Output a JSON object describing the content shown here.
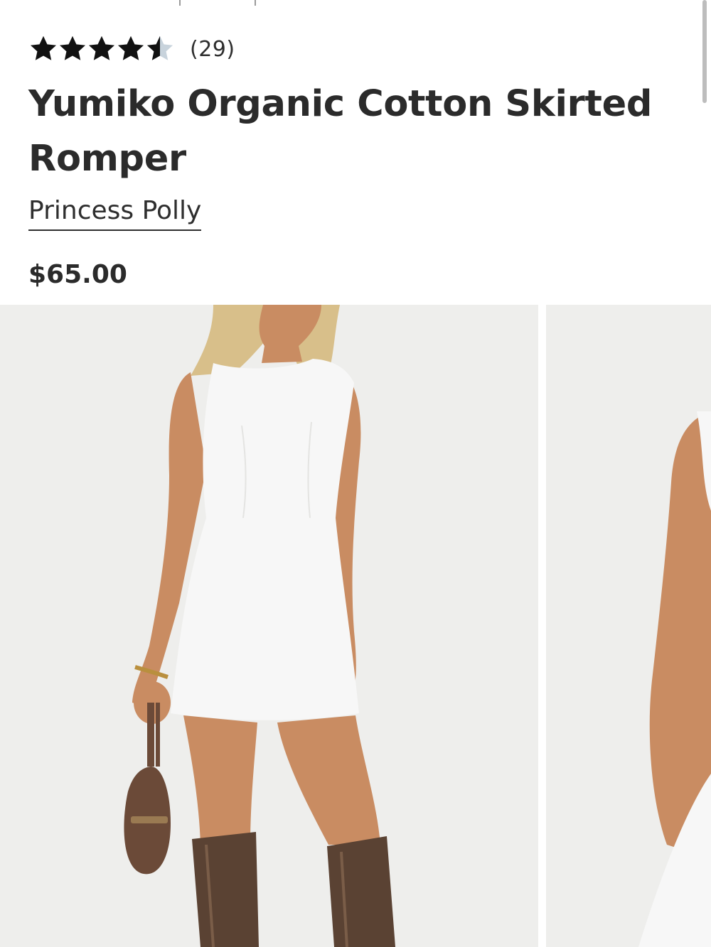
{
  "rating": {
    "value": 4.5,
    "max": 5,
    "count_text": "(29)",
    "star_color": "#111111",
    "empty_star_color": "#c8d3dc"
  },
  "product": {
    "title": "Yumiko Organic Cotton Skirted Romper",
    "brand": "Princess Polly",
    "price": "$65.00"
  },
  "gallery": {
    "images": [
      {
        "icon": "product-photo-front"
      },
      {
        "icon": "product-photo-side"
      }
    ]
  },
  "colors": {
    "text": "#2b2b2b",
    "photo_background": "#eeeeec",
    "dress": "#f7f7f7",
    "skin": "#c98c62",
    "boots": "#5a4233",
    "bag": "#6b4a38",
    "hair": "#d8bf8a"
  }
}
